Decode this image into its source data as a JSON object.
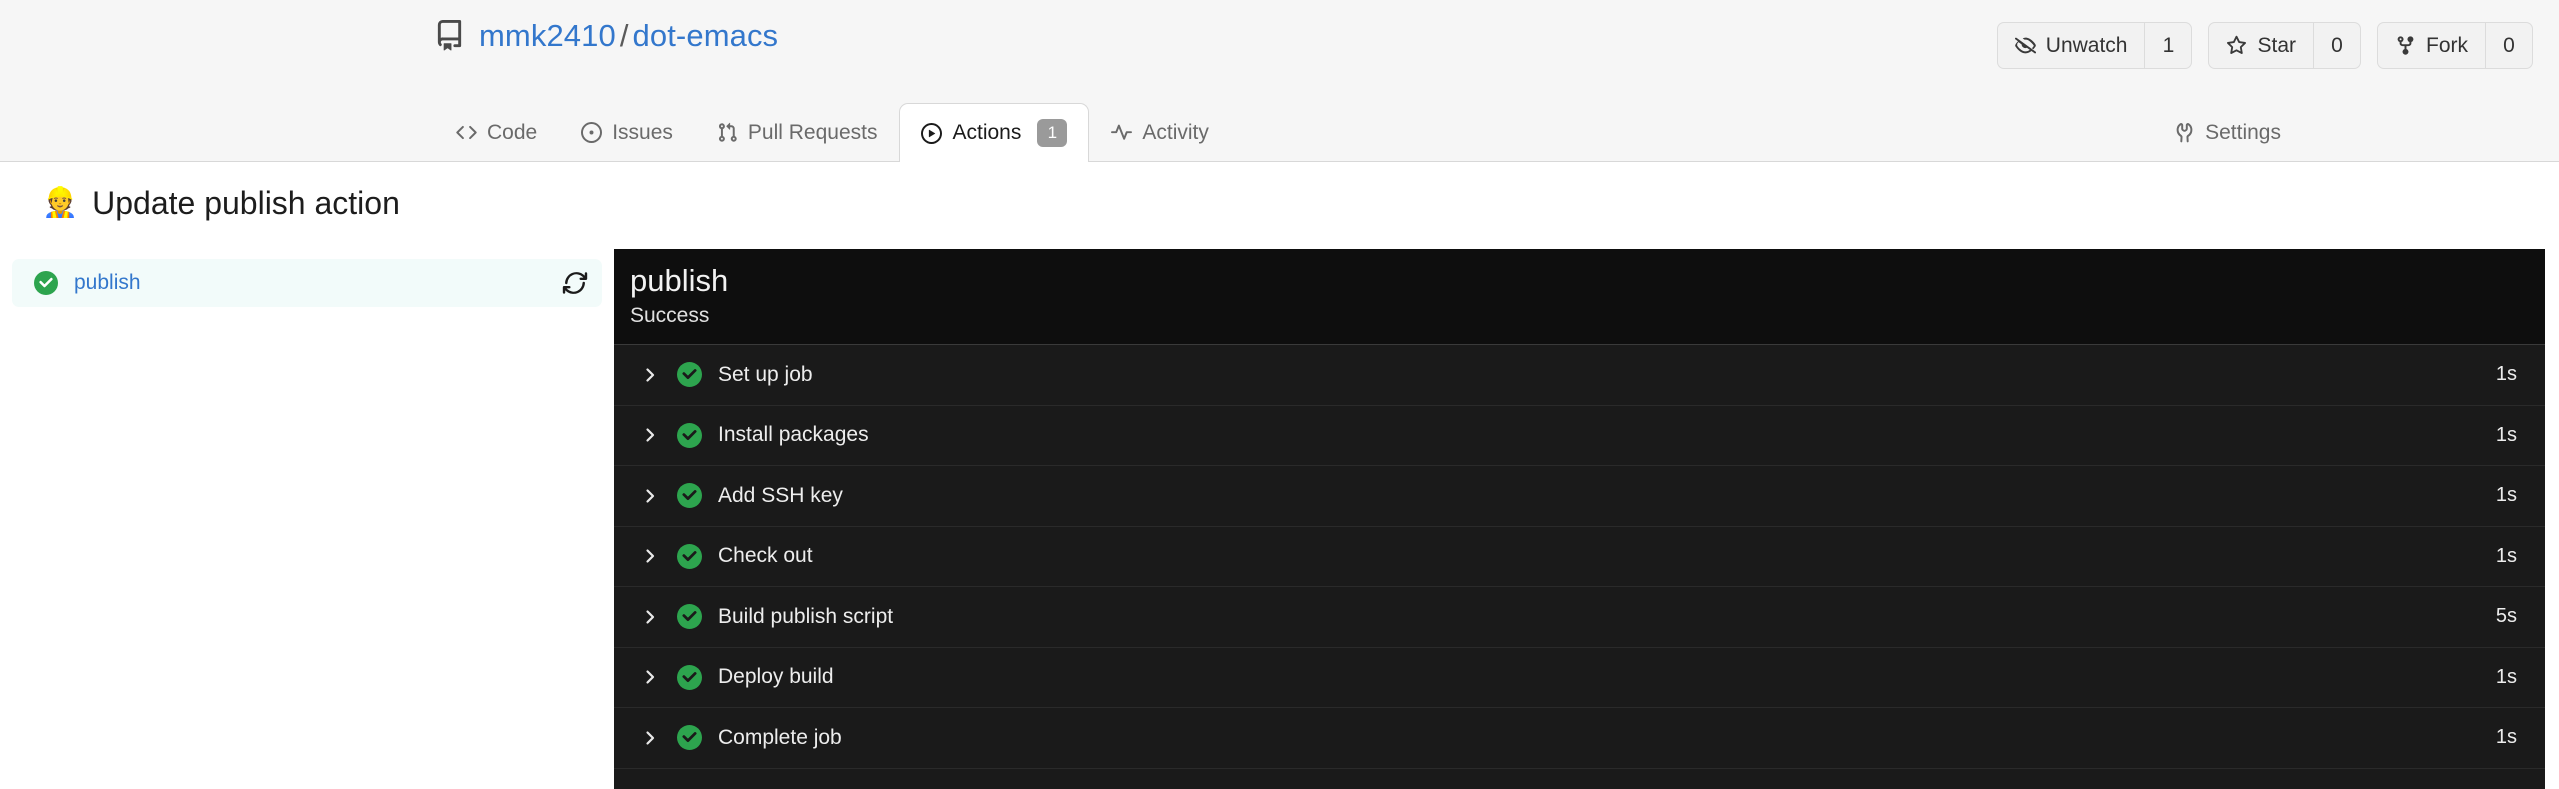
{
  "header": {
    "repo_icon": "repo-book-icon",
    "owner": "mmk2410",
    "separator": "/",
    "name": "dot-emacs",
    "actions": [
      {
        "icon": "eye-closed-icon",
        "label": "Unwatch",
        "count": "1"
      },
      {
        "icon": "star-icon",
        "label": "Star",
        "count": "0"
      },
      {
        "icon": "fork-icon",
        "label": "Fork",
        "count": "0"
      }
    ],
    "tabs": [
      {
        "icon": "code-icon",
        "label": "Code",
        "active": false,
        "badge": null
      },
      {
        "icon": "issue-opened-icon",
        "label": "Issues",
        "active": false,
        "badge": null
      },
      {
        "icon": "pull-request-icon",
        "label": "Pull Requests",
        "active": false,
        "badge": null
      },
      {
        "icon": "play-circle-icon",
        "label": "Actions",
        "active": true,
        "badge": "1"
      },
      {
        "icon": "pulse-icon",
        "label": "Activity",
        "active": false,
        "badge": null
      }
    ],
    "settings_tab": {
      "icon": "wrench-icon",
      "label": "Settings"
    }
  },
  "page": {
    "emoji": "👷",
    "emoji_name": "construction-worker-emoji",
    "title": "Update publish action"
  },
  "sidebar": {
    "jobs": [
      {
        "status_icon": "check-circle-success-icon",
        "label": "publish",
        "rerun_icon": "rerun-sync-icon",
        "selected": true
      }
    ]
  },
  "log": {
    "title": "publish",
    "status": "Success",
    "steps": [
      {
        "chevron": "chevron-right-icon",
        "status_icon": "check-circle-success-icon",
        "name": "Set up job",
        "duration": "1s"
      },
      {
        "chevron": "chevron-right-icon",
        "status_icon": "check-circle-success-icon",
        "name": "Install packages",
        "duration": "1s"
      },
      {
        "chevron": "chevron-right-icon",
        "status_icon": "check-circle-success-icon",
        "name": "Add SSH key",
        "duration": "1s"
      },
      {
        "chevron": "chevron-right-icon",
        "status_icon": "check-circle-success-icon",
        "name": "Check out",
        "duration": "1s"
      },
      {
        "chevron": "chevron-right-icon",
        "status_icon": "check-circle-success-icon",
        "name": "Build publish script",
        "duration": "5s"
      },
      {
        "chevron": "chevron-right-icon",
        "status_icon": "check-circle-success-icon",
        "name": "Deploy build",
        "duration": "1s"
      },
      {
        "chevron": "chevron-right-icon",
        "status_icon": "check-circle-success-icon",
        "name": "Complete job",
        "duration": "1s"
      }
    ]
  },
  "colors": {
    "success_green": "#2da44e",
    "link_blue": "#3377cc",
    "header_bg": "#f6f6f6",
    "log_bg": "#1a1a1a",
    "log_header_bg": "#0e0e0e",
    "selected_row_bg": "#f2fbfa"
  }
}
